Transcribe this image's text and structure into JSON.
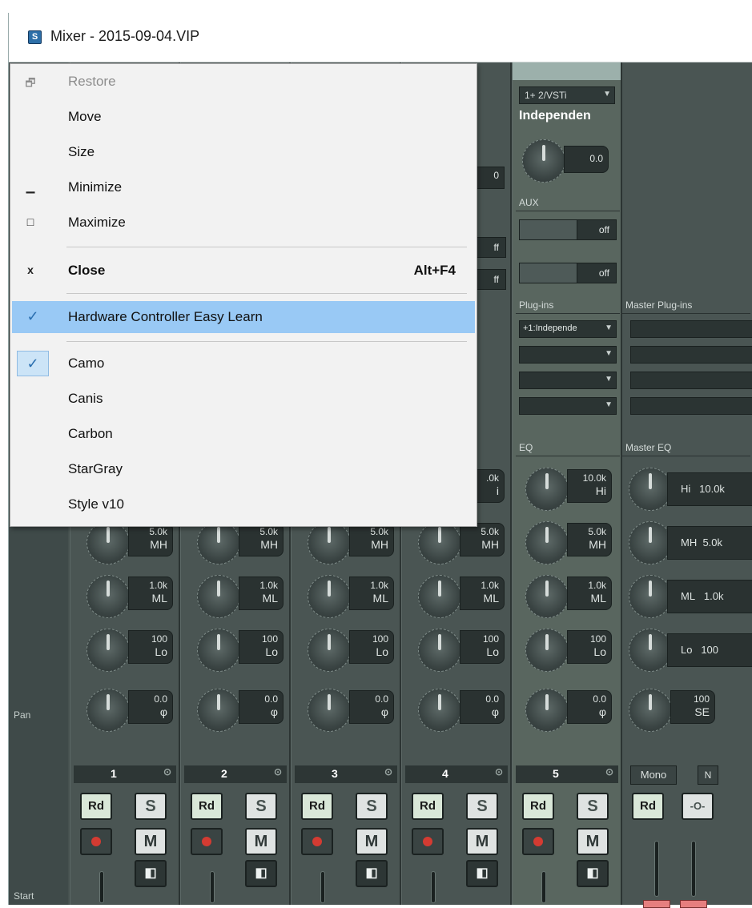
{
  "window": {
    "title": "Mixer - 2015-09-04.VIP",
    "app_icon_glyph": "S"
  },
  "side_labels": {
    "pan": "Pan",
    "start": "Start"
  },
  "strips": [
    {
      "number": "1",
      "eq": {
        "mh": "5.0k",
        "ml": "1.0k",
        "lo": "100"
      },
      "pan": "0.0"
    },
    {
      "number": "2",
      "eq": {
        "mh": "5.0k",
        "ml": "1.0k",
        "lo": "100"
      },
      "pan": "0.0"
    },
    {
      "number": "3",
      "eq": {
        "mh": "5.0k",
        "ml": "1.0k",
        "lo": "100"
      },
      "pan": "0.0"
    },
    {
      "number": "4",
      "eq": {
        "hi_partial": ".0k",
        "hi_band_partial": "i",
        "mh": "5.0k",
        "ml": "1.0k",
        "lo": "100"
      },
      "pan": "0.0",
      "partial": {
        "value": "0",
        "aux1": "ff",
        "aux2": "ff"
      }
    },
    {
      "number": "5",
      "input": "1+ 2/VSTi",
      "name": "Independen",
      "gain": "0.0",
      "aux_label": "AUX",
      "aux_sends": [
        "off",
        "off"
      ],
      "plugins_label": "Plug-ins",
      "plugin_first": "+1:Independe",
      "eq_label": "EQ",
      "eq": {
        "hi": "10.0k",
        "mh": "5.0k",
        "ml": "1.0k",
        "lo": "100"
      },
      "pan": "0.0"
    }
  ],
  "band_labels": {
    "hi": "Hi",
    "mh": "MH",
    "ml": "ML",
    "lo": "Lo",
    "phase": "φ"
  },
  "buttons": {
    "read": "Rd",
    "solo": "S",
    "mute": "M",
    "ring": "⊙",
    "speaker": "◧"
  },
  "master": {
    "plugins_label": "Master Plug-ins",
    "eq_label": "Master EQ",
    "eq": [
      {
        "band": "Hi",
        "value": "10.0k"
      },
      {
        "band": "MH",
        "value": "5.0k"
      },
      {
        "band": "ML",
        "value": "1.0k"
      },
      {
        "band": "Lo",
        "value": "100"
      }
    ],
    "width_value": "100",
    "width_label": "SE",
    "mono_label": "Mono",
    "n_label": "N",
    "link_icon": "-O-"
  },
  "system_menu": {
    "items": [
      {
        "label": "Restore",
        "icon": "restore-icon",
        "glyph": "🗗",
        "disabled": true
      },
      {
        "label": "Move"
      },
      {
        "label": "Size"
      },
      {
        "label": "Minimize",
        "icon": "minimize-icon",
        "glyph": "▁"
      },
      {
        "label": "Maximize",
        "icon": "maximize-icon",
        "glyph": "□"
      },
      {
        "label": "Close",
        "icon": "close-icon",
        "glyph": "x",
        "shortcut": "Alt+F4",
        "bold": true
      },
      {
        "label": "Hardware Controller Easy Learn",
        "checked": true,
        "highlighted": true
      },
      {
        "label": "Camo",
        "checked": true
      },
      {
        "label": "Canis"
      },
      {
        "label": "Carbon"
      },
      {
        "label": "StarGray"
      },
      {
        "label": "Style v10"
      }
    ],
    "check_glyph": "✓",
    "highlight_color": "#99c9f5"
  }
}
